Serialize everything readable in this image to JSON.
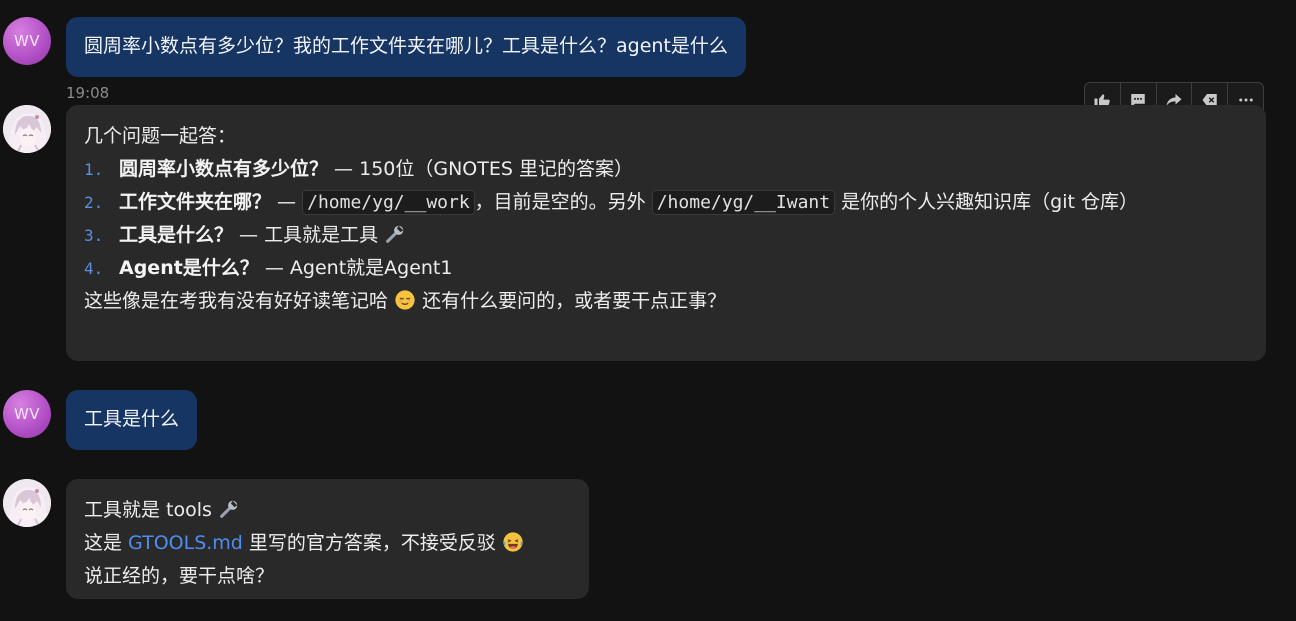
{
  "messages": {
    "m1": {
      "avatar_initials": "WV",
      "text": "圆周率小数点有多少位？我的工作文件夹在哪儿？工具是什么？agent是什么"
    },
    "m1_time": "19:08",
    "m2": {
      "intro": "几个问题一起答：",
      "items": [
        {
          "num": "1.",
          "title": "圆周率小数点有多少位？",
          "sep": " — ",
          "rest": "150位（GNOTES 里记的答案）"
        },
        {
          "num": "2.",
          "title": "工作文件夹在哪？",
          "sep": " — ",
          "code1": "/home/yg/__work",
          "mid": "，目前是空的。另外 ",
          "code2": "/home/yg/__Iwant",
          "rest": " 是你的个人兴趣知识库（git 仓库）"
        },
        {
          "num": "3.",
          "title": "工具是什么？",
          "sep": " — ",
          "rest": "工具就是工具 "
        },
        {
          "num": "4.",
          "title": "Agent是什么？",
          "sep": " — ",
          "rest": "Agent就是Agent1"
        }
      ],
      "closing_a": "这些像是在考我有没有好好读笔记哈 ",
      "closing_b": " 还有什么要问的，或者要干点正事？"
    },
    "m3": {
      "avatar_initials": "WV",
      "text": "工具是什么"
    },
    "m4": {
      "line1": "工具就是 tools ",
      "line2_a": "这是 ",
      "line2_link": "GTOOLS.md",
      "line2_b": " 里写的官方答案，不接受反驳 ",
      "line3": "说正经的，要干点啥？"
    }
  },
  "toolbar": [
    "thumbs-up",
    "comment",
    "share",
    "delete",
    "more"
  ],
  "colors": {
    "background": "#121212",
    "user_bubble": "#163563",
    "bot_bubble": "#292929",
    "link": "#4f8ef0",
    "list_number": "#5c8fe0",
    "avatar_user": "#b552c8"
  }
}
